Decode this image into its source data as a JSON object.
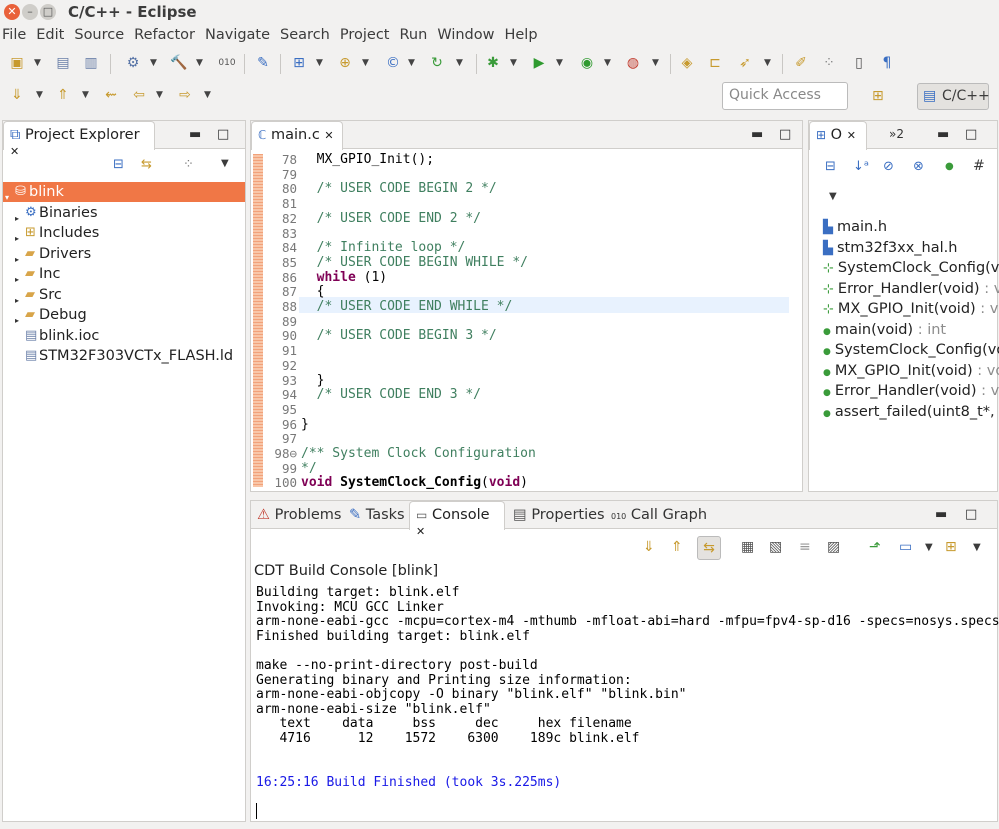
{
  "window": {
    "title": "C/C++ - Eclipse"
  },
  "menu": [
    "File",
    "Edit",
    "Source",
    "Refactor",
    "Navigate",
    "Search",
    "Project",
    "Run",
    "Window",
    "Help"
  ],
  "toolbar": {
    "quick_access_placeholder": "Quick Access",
    "perspective_label": "C/C++"
  },
  "project_explorer": {
    "tab_label": "Project Explorer",
    "items": [
      {
        "label": "blink",
        "icon": "project-icon",
        "selected": true
      },
      {
        "label": "Binaries",
        "icon": "binaries-icon"
      },
      {
        "label": "Includes",
        "icon": "includes-icon"
      },
      {
        "label": "Drivers",
        "icon": "folder-icon"
      },
      {
        "label": "Inc",
        "icon": "folder-icon"
      },
      {
        "label": "Src",
        "icon": "folder-icon"
      },
      {
        "label": "Debug",
        "icon": "folder-icon"
      },
      {
        "label": "blink.ioc",
        "icon": "file-icon"
      },
      {
        "label": "STM32F303VCTx_FLASH.ld",
        "icon": "file-icon"
      }
    ]
  },
  "editor": {
    "tab_label": "main.c",
    "lines": [
      {
        "n": "78",
        "text": "  MX_GPIO_Init();"
      },
      {
        "n": "79",
        "text": ""
      },
      {
        "n": "80",
        "text": "  /* USER CODE BEGIN 2 */"
      },
      {
        "n": "81",
        "text": ""
      },
      {
        "n": "82",
        "text": "  /* USER CODE END 2 */"
      },
      {
        "n": "83",
        "text": ""
      },
      {
        "n": "84",
        "text": "  /* Infinite loop */"
      },
      {
        "n": "85",
        "text": "  /* USER CODE BEGIN WHILE */"
      },
      {
        "n": "86",
        "text": "  while (1)"
      },
      {
        "n": "87",
        "text": "  {"
      },
      {
        "n": "88",
        "text": "  /* USER CODE END WHILE */"
      },
      {
        "n": "89",
        "text": ""
      },
      {
        "n": "90",
        "text": "  /* USER CODE BEGIN 3 */"
      },
      {
        "n": "91",
        "text": ""
      },
      {
        "n": "92",
        "text": ""
      },
      {
        "n": "93",
        "text": "  }"
      },
      {
        "n": "94",
        "text": "  /* USER CODE END 3 */"
      },
      {
        "n": "95",
        "text": ""
      },
      {
        "n": "96",
        "text": "}"
      },
      {
        "n": "97",
        "text": ""
      },
      {
        "n": "98⊖",
        "text": "/** System Clock Configuration"
      },
      {
        "n": "99",
        "text": "*/"
      },
      {
        "n": "100",
        "text": "void SystemClock_Config(void)"
      }
    ]
  },
  "outline": {
    "tab_label": "O",
    "tab2_label": "»2",
    "items": [
      {
        "name": "main.h",
        "type": ""
      },
      {
        "name": "stm32f3xx_hal.h",
        "type": ""
      },
      {
        "name": "SystemClock_Config(vo",
        "type": ""
      },
      {
        "name": "Error_Handler(void)",
        "type": " : v"
      },
      {
        "name": "MX_GPIO_Init(void)",
        "type": " : vo"
      },
      {
        "name": "main(void)",
        "type": " : int"
      },
      {
        "name": "SystemClock_Config(vo",
        "type": ""
      },
      {
        "name": "MX_GPIO_Init(void)",
        "type": " : vo"
      },
      {
        "name": "Error_Handler(void)",
        "type": " : v"
      },
      {
        "name": "assert_failed(uint8_t*,",
        "type": ""
      }
    ]
  },
  "bottom_tabs": [
    "Problems",
    "Tasks",
    "Console",
    "Properties",
    "Call Graph"
  ],
  "console": {
    "title": "CDT Build Console [blink]",
    "lines": [
      "Building target: blink.elf",
      "Invoking: MCU GCC Linker",
      "arm-none-eabi-gcc -mcpu=cortex-m4 -mthumb -mfloat-abi=hard -mfpu=fpv4-sp-d16 -specs=nosys.specs",
      "Finished building target: blink.elf",
      "",
      "make --no-print-directory post-build",
      "Generating binary and Printing size information:",
      "arm-none-eabi-objcopy -O binary \"blink.elf\" \"blink.bin\"",
      "arm-none-eabi-size \"blink.elf\"",
      "   text    data     bss     dec     hex filename",
      "   4716      12    1572    6300    189c blink.elf",
      "",
      "",
      "16:25:16 Build Finished (took 3s.225ms)"
    ]
  },
  "colors": {
    "selection": "#f07746",
    "comment": "#3f7f5f",
    "keyword": "#7f0055",
    "console_info": "#1919e6"
  }
}
